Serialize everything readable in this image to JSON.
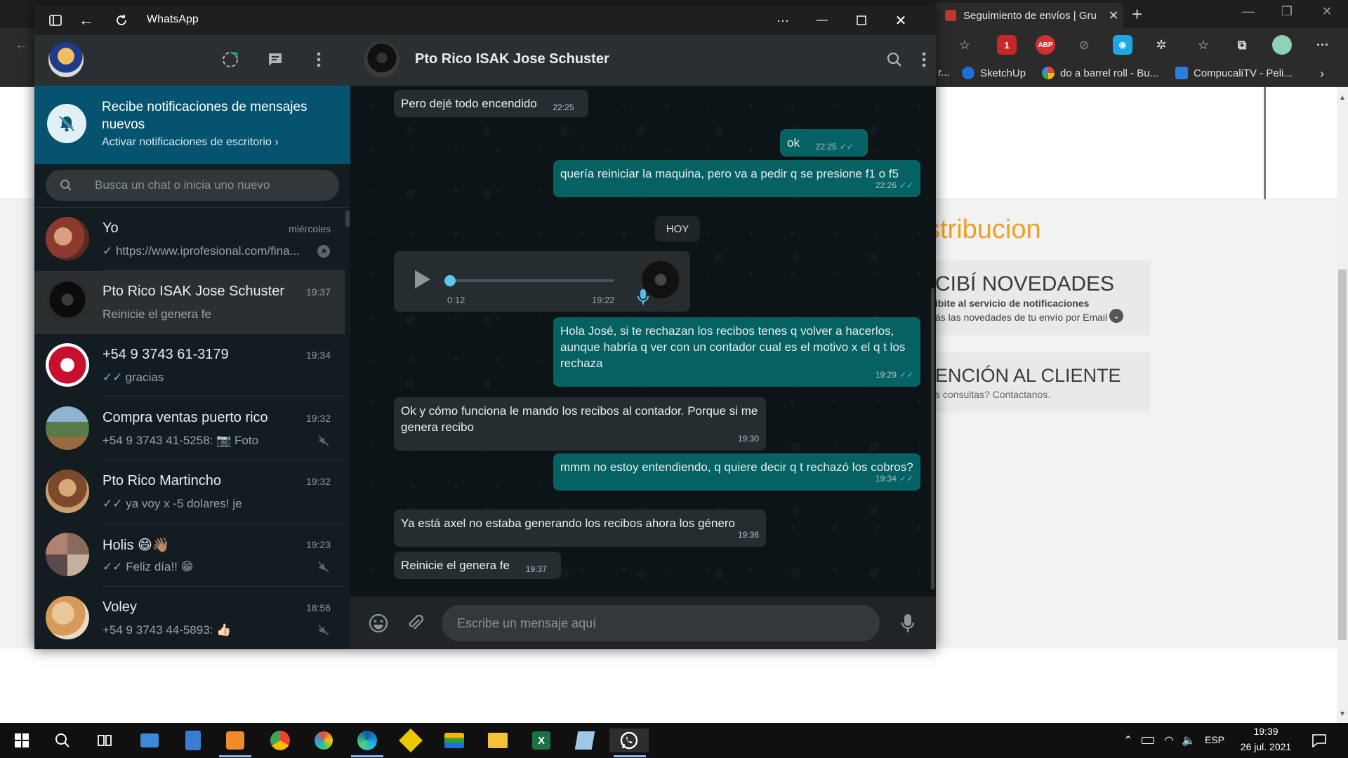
{
  "browser": {
    "tab_title": "Seguimiento de envíos | Grupo L",
    "bookmarks": [
      "r...",
      "SketchUp",
      "do a barrel roll - Bu...",
      "CompucaliTV - Peli..."
    ],
    "page": {
      "heading": "stribucion",
      "card1_title": "CIBÍ NOVEDADES",
      "card1_line1": "ibite al servicio de notificaciones",
      "card1_line2": "ás las novedades de tu envío por Email",
      "card2_title": "ENCIÓN AL CLIENTE",
      "card2_line1": "s consultas? Contactanos."
    }
  },
  "window": {
    "title": "WhatsApp",
    "more": "···"
  },
  "notification": {
    "title": "Recibe notificaciones de mensajes nuevos",
    "link": "Activar notificaciones de escritorio ›"
  },
  "search": {
    "placeholder": "Busca un chat o inicia uno nuevo"
  },
  "chats": [
    {
      "name": "Yo",
      "time": "miércoles",
      "preview": "✓ https://www.iprofesional.com/fina...",
      "icon": "pin-icon",
      "color": "#8a3b2e"
    },
    {
      "name": "Pto Rico ISAK Jose Schuster",
      "time": "19:37",
      "preview": "Reinicie el genera fe",
      "icon": "",
      "color": "#111111"
    },
    {
      "name": "+54 9 3743 61-3179",
      "time": "19:34",
      "preview": "gracias",
      "icon": "",
      "color": "#c8102e"
    },
    {
      "name": "Compra ventas puerto rico",
      "time": "19:32",
      "preview": "+54 9 3743 41-5258: 📷 Foto",
      "icon": "muted-icon",
      "color": "#5b7a4a"
    },
    {
      "name": "Pto Rico Martincho",
      "time": "19:32",
      "preview": "✓✓ ya voy x -5 dolares! je",
      "icon": "",
      "color": "#b07850"
    },
    {
      "name": "Holis 😄👋🏽",
      "time": "19:23",
      "preview": "✓✓ Feliz día!! 😁",
      "icon": "muted-icon",
      "color": "#8a6a5a"
    },
    {
      "name": "Voley",
      "time": "18:56",
      "preview": "+54 9 3743 44-5893: 👍🏻",
      "icon": "muted-icon",
      "color": "#c9a46a"
    }
  ],
  "contact": {
    "name": "Pto Rico ISAK Jose Schuster"
  },
  "messages": [
    {
      "dir": "in",
      "text": "Pero dejé todo encendido",
      "time": "22:25"
    },
    {
      "dir": "out",
      "text": "ok",
      "time": "22:25"
    },
    {
      "dir": "out",
      "text": "quería reiniciar la maquina, pero va a pedir q se presione f1 o f5",
      "time": "22:26"
    },
    {
      "dir": "out",
      "text": "Hola José, si te rechazan los recibos tenes q volver a hacerlos, aunque habría q ver con un contador cual es el motivo x el q t los rechaza",
      "time": "19:29"
    },
    {
      "dir": "in",
      "text": "Ok y cómo funciona le mando los recibos al contador. Porque si me genera recibo",
      "time": "19:30"
    },
    {
      "dir": "out",
      "text": "mmm no estoy entendiendo, q quiere decir q t rechazó los cobros?",
      "time": "19:34"
    },
    {
      "dir": "in",
      "text": "Ya está axel no estaba generando los recibos ahora los género",
      "time": "19:36"
    },
    {
      "dir": "in",
      "text": "Reinicie el genera fe",
      "time": "19:37"
    }
  ],
  "day_chip": "HOY",
  "voice_note": {
    "duration": "0:12",
    "time": "19:22",
    "progress": 0
  },
  "composer": {
    "placeholder": "Escribe un mensaje aquí"
  },
  "taskbar": {
    "lang": "ESP",
    "time": "19:39",
    "date": "26 jul. 2021"
  },
  "colors": {
    "accent": "#056162",
    "banner": "#06536f",
    "tick_blue": "#53bdeb"
  }
}
